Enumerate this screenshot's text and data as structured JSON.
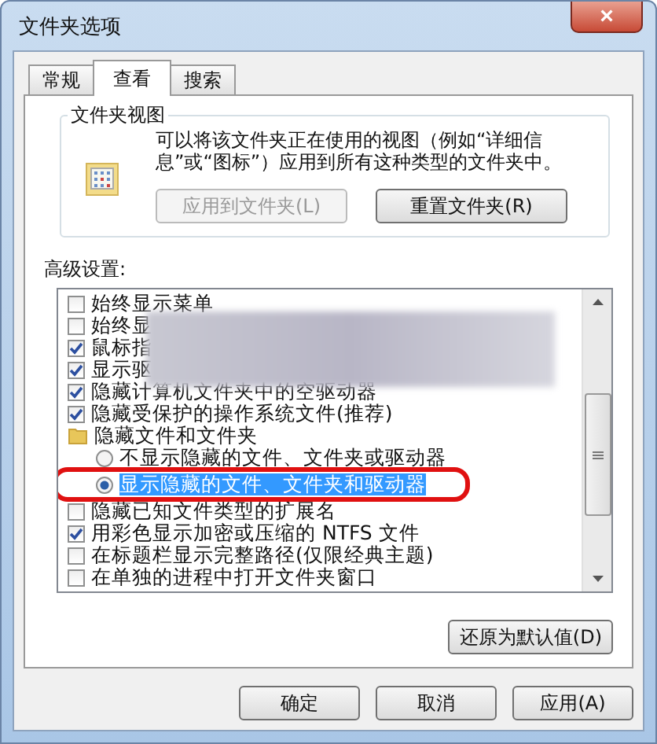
{
  "window": {
    "title": "文件夹选项",
    "close": "×"
  },
  "tabs": [
    {
      "label": "常规",
      "selected": false
    },
    {
      "label": "查看",
      "selected": true
    },
    {
      "label": "搜索",
      "selected": false
    }
  ],
  "folder_views": {
    "title": "文件夹视图",
    "description": "可以将该文件夹正在使用的视图（例如“详细信息”或“图标”）应用到所有这种类型的文件夹中。",
    "buttons": [
      {
        "label": "应用到文件夹(L)",
        "disabled": true
      },
      {
        "label": "重置文件夹(R)",
        "disabled": false
      }
    ]
  },
  "advanced": {
    "label": "高级设置:",
    "items": [
      {
        "kind": "checkbox",
        "label": "始终显示菜单",
        "checked": false
      },
      {
        "kind": "checkbox",
        "label": "始终显",
        "checked": false
      },
      {
        "kind": "checkbox",
        "label": "鼠标指",
        "checked": true
      },
      {
        "kind": "checkbox",
        "label": "显示驱",
        "checked": true
      },
      {
        "kind": "checkbox",
        "label": "隐藏计算机文件夹中的空驱动器",
        "checked": true
      },
      {
        "kind": "checkbox",
        "label": "隐藏受保护的操作系统文件(推荐)",
        "checked": true
      },
      {
        "kind": "folder",
        "label": "隐藏文件和文件夹"
      },
      {
        "kind": "radio",
        "label": "不显示隐藏的文件、文件夹或驱动器",
        "selected": false
      },
      {
        "kind": "radio",
        "label": "显示隐藏的文件、文件夹和驱动器",
        "selected": true
      },
      {
        "kind": "checkbox",
        "label": "隐藏已知文件类型的扩展名",
        "checked": false
      },
      {
        "kind": "checkbox",
        "label": "用彩色显示加密或压缩的 NTFS 文件",
        "checked": true
      },
      {
        "kind": "checkbox",
        "label": "在标题栏显示完整路径(仅限经典主题)",
        "checked": false
      },
      {
        "kind": "checkbox",
        "label": "在单独的进程中打开文件夹窗口",
        "checked": false
      }
    ],
    "restore_button": "还原为默认值(D)"
  },
  "buttons": [
    "确定",
    "取消",
    "应用(A)"
  ]
}
